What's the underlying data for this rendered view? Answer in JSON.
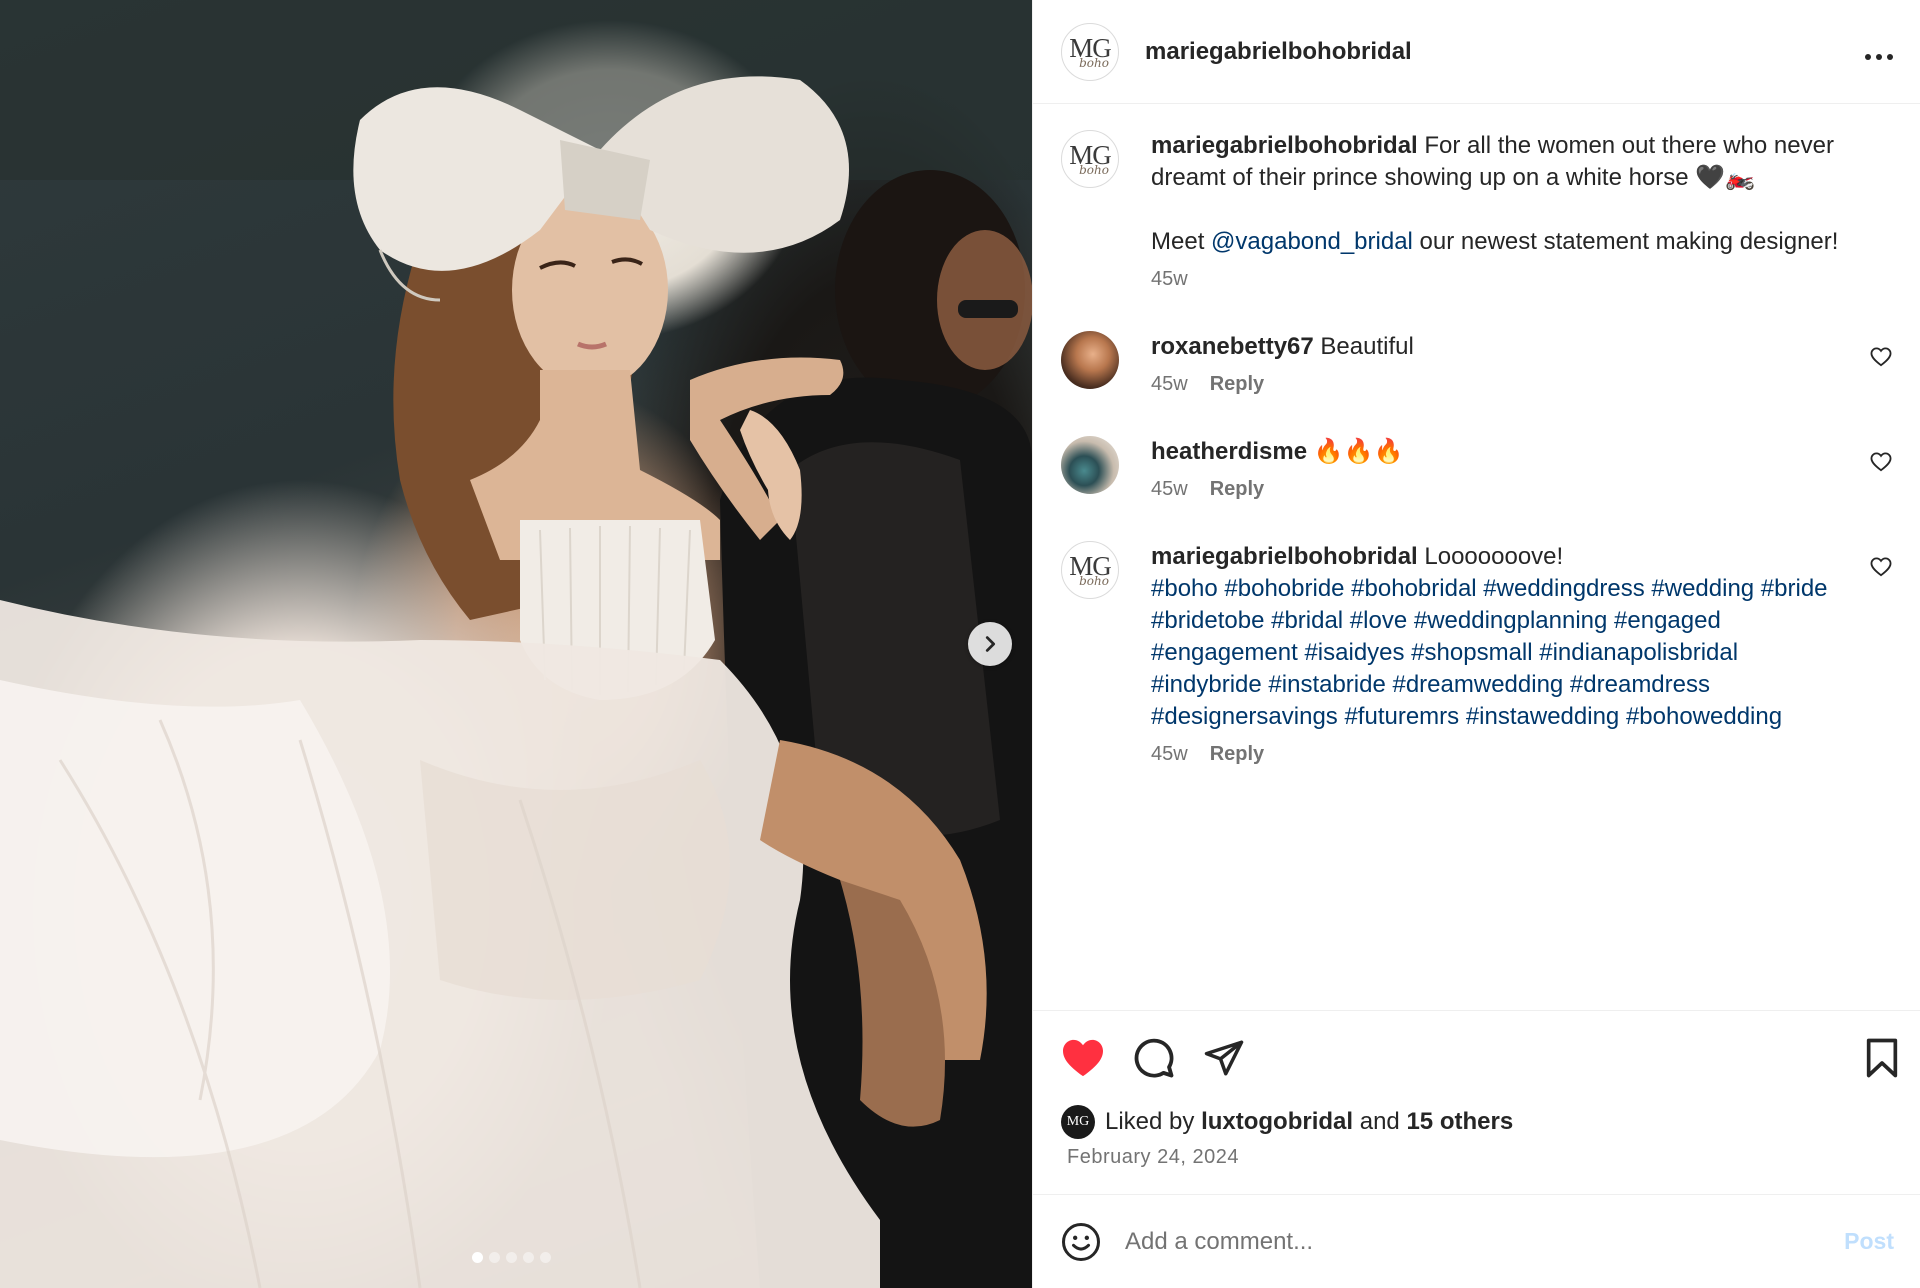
{
  "post": {
    "username": "mariegabrielbohobridal",
    "avatar_monogram": "MG",
    "avatar_script": "boho",
    "more_icon": "more-horizontal-icon",
    "carousel": {
      "total_slides": 5,
      "active_slide": 1
    },
    "caption": {
      "username": "mariegabrielbohobridal",
      "text_1": " For all the women out there who never dreamt of their prince showing up on a white horse 🖤🏍️",
      "text_2_prefix": "Meet ",
      "mention": "@vagabond_bridal",
      "text_2_suffix": " our newest statement making designer!",
      "time": "45w"
    },
    "comments": [
      {
        "username": "roxanebetty67",
        "text": " Beautiful",
        "time": "45w",
        "reply": "Reply"
      },
      {
        "username": "heatherdisme",
        "text": " 🔥🔥🔥",
        "time": "45w",
        "reply": "Reply"
      },
      {
        "username": "mariegabrielbohobridal",
        "text": " Looooooove!",
        "hashtags": "#boho #bohobride #bohobridal #weddingdress #wedding #bride #bridetobe #bridal #love #weddingplanning #engaged #engagement #isaidyes #shopsmall #indianapolisbridal #indybride #instabride #dreamwedding #dreamdress #designersavings #futuremrs #instawedding #bohowedding",
        "time": "45w",
        "reply": "Reply"
      }
    ],
    "likes": {
      "prefix": "Liked by ",
      "user": "luxtogobridal",
      "middle": " and ",
      "others": "15 others",
      "liked": true
    },
    "date": "February 24, 2024",
    "add_comment": {
      "placeholder": "Add a comment...",
      "post_label": "Post"
    },
    "colors": {
      "heart_red": "#ff3040",
      "link_blue": "#00376b",
      "post_disabled": "#c0dffd",
      "meta_gray": "#737373"
    }
  }
}
